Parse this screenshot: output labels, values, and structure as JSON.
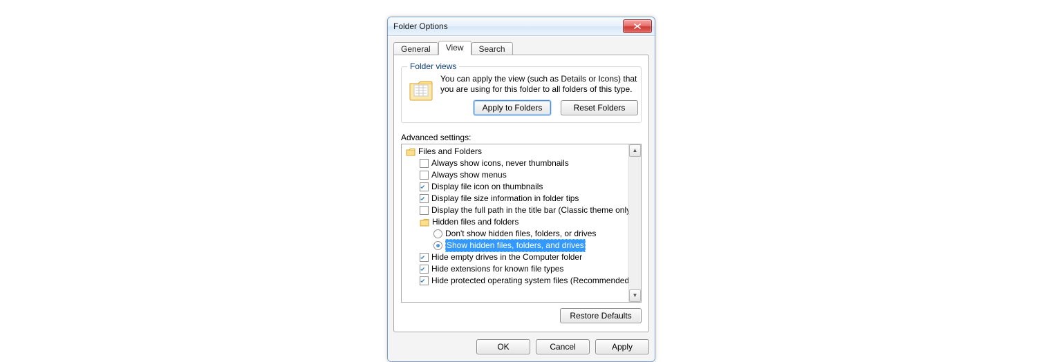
{
  "window": {
    "title": "Folder Options"
  },
  "tabs": {
    "general": "General",
    "view": "View",
    "search": "Search",
    "active": "view"
  },
  "folderViews": {
    "group_title": "Folder views",
    "description": "You can apply the view (such as Details or Icons) that you are using for this folder to all folders of this type.",
    "apply_label": "Apply to Folders",
    "reset_label": "Reset Folders"
  },
  "advanced": {
    "label": "Advanced settings:",
    "root_label": "Files and Folders",
    "items": [
      {
        "id": "always_icons",
        "type": "checkbox",
        "checked": false,
        "label": "Always show icons, never thumbnails"
      },
      {
        "id": "always_menus",
        "type": "checkbox",
        "checked": false,
        "label": "Always show menus"
      },
      {
        "id": "file_icon_thumbs",
        "type": "checkbox",
        "checked": true,
        "label": "Display file icon on thumbnails"
      },
      {
        "id": "size_in_tips",
        "type": "checkbox",
        "checked": true,
        "label": "Display file size information in folder tips"
      },
      {
        "id": "full_path_titlebar",
        "type": "checkbox",
        "checked": false,
        "label": "Display the full path in the title bar (Classic theme only)"
      },
      {
        "id": "hidden_group",
        "type": "folder",
        "label": "Hidden files and folders"
      },
      {
        "id": "dont_show_hidden",
        "type": "radio",
        "checked": false,
        "label": "Don't show hidden files, folders, or drives"
      },
      {
        "id": "show_hidden",
        "type": "radio",
        "checked": true,
        "label": "Show hidden files, folders, and drives",
        "selected": true
      },
      {
        "id": "hide_empty_drives",
        "type": "checkbox",
        "checked": true,
        "label": "Hide empty drives in the Computer folder"
      },
      {
        "id": "hide_extensions",
        "type": "checkbox",
        "checked": true,
        "label": "Hide extensions for known file types"
      },
      {
        "id": "hide_protected_os",
        "type": "checkbox",
        "checked": true,
        "label": "Hide protected operating system files (Recommended)"
      }
    ],
    "restore_label": "Restore Defaults"
  },
  "buttons": {
    "ok": "OK",
    "cancel": "Cancel",
    "apply": "Apply"
  }
}
